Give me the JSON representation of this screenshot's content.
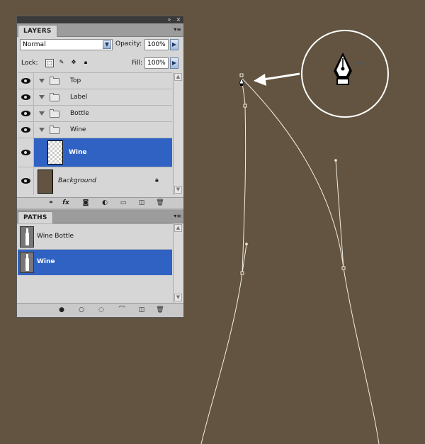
{
  "layers_panel": {
    "tab_label": "LAYERS",
    "blend_mode": "Normal",
    "opacity_label": "Opacity:",
    "opacity_value": "100%",
    "lock_label": "Lock:",
    "fill_label": "Fill:",
    "fill_value": "100%",
    "layers": [
      {
        "name": "Top",
        "type": "group",
        "visible": true
      },
      {
        "name": "Label",
        "type": "group",
        "visible": true
      },
      {
        "name": "Bottle",
        "type": "group",
        "visible": true
      },
      {
        "name": "Wine",
        "type": "group",
        "visible": true
      },
      {
        "name": "Wine",
        "type": "layer",
        "visible": true,
        "selected": true
      },
      {
        "name": "Background",
        "type": "background",
        "visible": true,
        "locked": true
      }
    ]
  },
  "paths_panel": {
    "tab_label": "PATHS",
    "paths": [
      {
        "name": "Wine Bottle",
        "selected": false
      },
      {
        "name": "Wine",
        "selected": true
      }
    ]
  },
  "colors": {
    "canvas": "#625440",
    "selection": "#3062c4",
    "path_stroke": "#ffffff"
  },
  "icons": {
    "panel_collapse": "double-chevron-right-icon",
    "panel_close": "close-icon",
    "tool_cursor": "pen-tool-minus-icon"
  }
}
